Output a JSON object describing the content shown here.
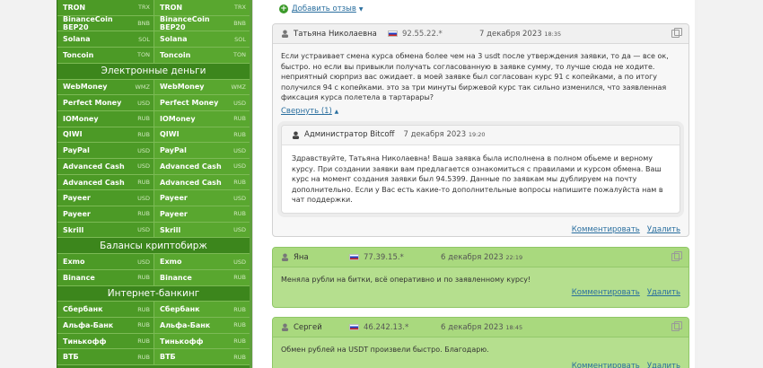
{
  "sidebar": {
    "pairs_top": [
      {
        "l": "TRON",
        "lc": "TRX",
        "r": "TRON",
        "rc": "TRX"
      },
      {
        "l": "BinanceCoin BEP20",
        "lc": "BNB",
        "r": "BinanceCoin BEP20",
        "rc": "BNB"
      },
      {
        "l": "Solana",
        "lc": "SOL",
        "r": "Solana",
        "rc": "SOL"
      },
      {
        "l": "Toncoin",
        "lc": "TON",
        "r": "Toncoin",
        "rc": "TON"
      }
    ],
    "section1": "Электронные деньги",
    "pairs_emoney": [
      {
        "l": "WebMoney",
        "lc": "WMZ",
        "r": "WebMoney",
        "rc": "WMZ"
      },
      {
        "l": "Perfect Money",
        "lc": "USD",
        "r": "Perfect Money",
        "rc": "USD"
      },
      {
        "l": "IOMoney",
        "lc": "RUB",
        "r": "IOMoney",
        "rc": "RUB"
      },
      {
        "l": "QIWI",
        "lc": "RUB",
        "r": "QIWI",
        "rc": "RUB"
      },
      {
        "l": "PayPal",
        "lc": "USD",
        "r": "PayPal",
        "rc": "USD"
      },
      {
        "l": "Advanced Cash",
        "lc": "USD",
        "r": "Advanced Cash",
        "rc": "USD"
      },
      {
        "l": "Advanced Cash",
        "lc": "RUB",
        "r": "Advanced Cash",
        "rc": "RUB"
      },
      {
        "l": "Payeer",
        "lc": "USD",
        "r": "Payeer",
        "rc": "USD"
      },
      {
        "l": "Payeer",
        "lc": "RUB",
        "r": "Payeer",
        "rc": "RUB"
      },
      {
        "l": "Skrill",
        "lc": "USD",
        "r": "Skrill",
        "rc": "USD"
      }
    ],
    "section2": "Балансы криптобирж",
    "pairs_exchanges": [
      {
        "l": "Exmo",
        "lc": "USD",
        "r": "Exmo",
        "rc": "USD"
      },
      {
        "l": "Binance",
        "lc": "RUB",
        "r": "Binance",
        "rc": "RUB"
      }
    ],
    "section3": "Интернет-банкинг",
    "pairs_banking": [
      {
        "l": "Сбербанк",
        "lc": "RUB",
        "r": "Сбербанк",
        "rc": "RUB"
      },
      {
        "l": "Альфа-Банк",
        "lc": "RUB",
        "r": "Альфа-Банк",
        "rc": "RUB"
      },
      {
        "l": "Тинькофф",
        "lc": "RUB",
        "r": "Тинькофф",
        "rc": "RUB"
      },
      {
        "l": "ВТБ",
        "lc": "RUB",
        "r": "ВТБ",
        "rc": "RUB"
      }
    ]
  },
  "add_review": "Добавить отзыв",
  "reviews": [
    {
      "name": "Татьяна Николаевна",
      "ip": "92.55.22.*",
      "date": "7 декабря 2023",
      "time": "18:35",
      "text": "Если устраивает смена курса обмена более чем на 3 usdt после утверждения заявки, то да — все ок, быстро. но если вы привыкли получать согласованную в заявке сумму, то лучше сюда не ходите. неприятный сюрприз вас ожидает. в моей заявке был согласован курс 91 с копейками, а по итогу получился 94 с копейками. это за три минуты биржевой курс так сильно изменился, что заявленная фиксация курса полетела в тартарары?",
      "collapse": "Свернуть (1)",
      "admin_name": "Администратор Bitcoff",
      "admin_date": "7 декабря 2023",
      "admin_time": "19:20",
      "admin_text": "Здравствуйте, Татьяна Николаевна! Ваша заявка была исполнена в полном обьеме и верному курсу. При создании заявки вам предлагается ознакомиться с правилами и курсом обмена. Ваш курс на момент создания заявки был 94.5399. Данные по заявкам мы дублируем на почту дополнительно. Если у Вас есть какие-то дополнительные вопросы напишите пожалуйста нам в чат поддержки."
    },
    {
      "name": "Яна",
      "ip": "77.39.15.*",
      "date": "6 декабря 2023",
      "time": "22:19",
      "text": "Меняла рубли на битки, всё оперативно и по заявленному курсу!"
    },
    {
      "name": "Сергей",
      "ip": "46.242.13.*",
      "date": "6 декабря 2023",
      "time": "18:45",
      "text": "Обмен рублей на USDT произвели быстро. Благодарю."
    }
  ],
  "actions": {
    "comment": "Комментировать",
    "delete": "Удалить"
  }
}
